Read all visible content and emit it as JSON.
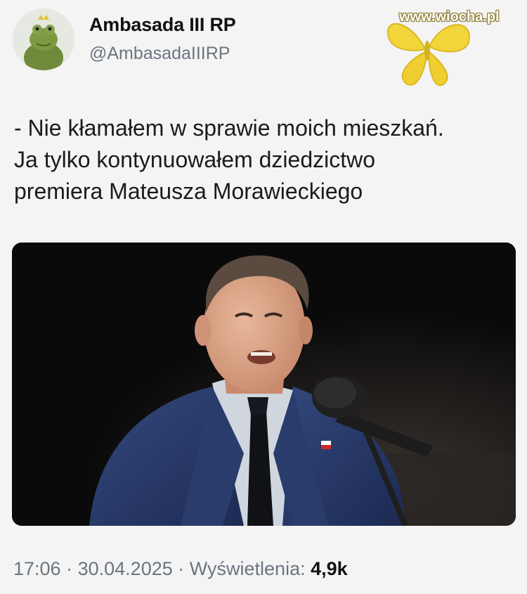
{
  "tweet": {
    "display_name": "Ambasada III RP",
    "handle": "@AmbasadaIIIRP",
    "text_lines": [
      "- Nie kłamałem w sprawie moich mieszkań.",
      "Ja tylko kontynuowałem dziedzictwo",
      "premiera Mateusza Morawieckiego"
    ],
    "time": "17:06",
    "date": "30.04.2025",
    "separator": "·",
    "views_label": "Wyświetlenia:",
    "views_count": "4,9k"
  },
  "watermark": {
    "text": "www.wiocha.pl"
  },
  "icons": {
    "avatar": "frog-plush-avatar-icon",
    "logo": "butterfly-logo-icon"
  },
  "colors": {
    "background": "#f4f4f4",
    "secondary_text": "#6b7580",
    "butterfly": "#f0d233"
  }
}
